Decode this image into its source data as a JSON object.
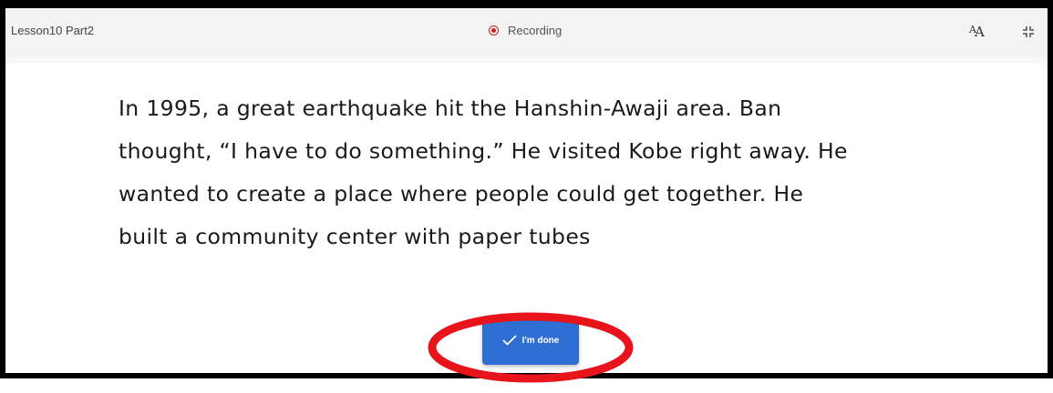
{
  "header": {
    "title": "Lesson10 Part2",
    "status": "Recording",
    "icons": [
      "recording-dot-icon",
      "font-size-icon",
      "collapse-icon"
    ]
  },
  "reading": {
    "text": "In 1995, a great earthquake hit the Hanshin-Awaji area.  Ban\nthought, “I have to do something.”  He visited Kobe right away.  He\nwanted to create a place where people could get together.  He\nbuilt a community center with paper tubes"
  },
  "actions": {
    "done_label": "I'm done"
  },
  "colors": {
    "accent": "#2f6ed2",
    "recording": "#cc2222",
    "annotation": "#e8141c",
    "frame": "#000000"
  }
}
